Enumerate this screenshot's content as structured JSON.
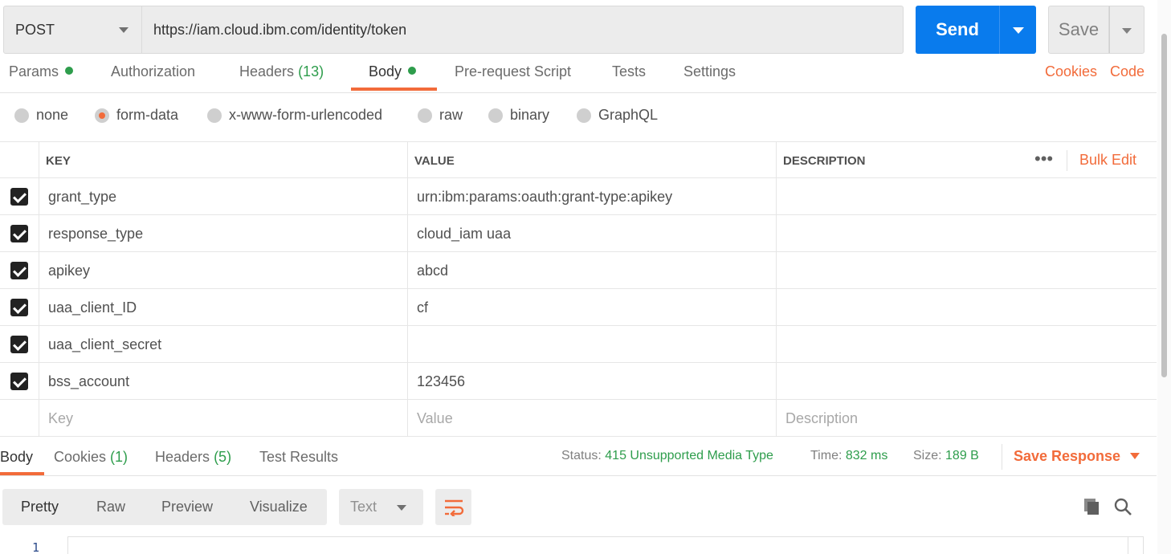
{
  "request": {
    "method": "POST",
    "url": "https://iam.cloud.ibm.com/identity/token",
    "send_label": "Send",
    "save_label": "Save"
  },
  "request_tabs": {
    "params": "Params",
    "authorization": "Authorization",
    "headers": "Headers",
    "headers_count": "(13)",
    "body": "Body",
    "prerequest": "Pre-request Script",
    "tests": "Tests",
    "settings": "Settings",
    "cookies": "Cookies",
    "code": "Code"
  },
  "body_types": {
    "none": "none",
    "form_data": "form-data",
    "urlencoded": "x-www-form-urlencoded",
    "raw": "raw",
    "binary": "binary",
    "graphql": "GraphQL",
    "selected": "form-data"
  },
  "table": {
    "headers": {
      "key": "KEY",
      "value": "VALUE",
      "description": "DESCRIPTION"
    },
    "more_label": "•••",
    "bulk_edit": "Bulk Edit",
    "rows": [
      {
        "key": "grant_type",
        "value": "urn:ibm:params:oauth:grant-type:apikey",
        "description": "",
        "checked": true
      },
      {
        "key": "response_type",
        "value": "cloud_iam uaa",
        "description": "",
        "checked": true
      },
      {
        "key": "apikey",
        "value": "abcd",
        "description": "",
        "checked": true
      },
      {
        "key": "uaa_client_ID",
        "value": "cf",
        "description": "",
        "checked": true
      },
      {
        "key": "uaa_client_secret",
        "value": "",
        "description": "",
        "checked": true
      },
      {
        "key": "bss_account",
        "value": "123456",
        "description": "",
        "checked": true
      }
    ],
    "placeholders": {
      "key": "Key",
      "value": "Value",
      "description": "Description"
    }
  },
  "response": {
    "tabs": {
      "body": "Body",
      "cookies": "Cookies",
      "cookies_count": "(1)",
      "headers": "Headers",
      "headers_count": "(5)",
      "test_results": "Test Results"
    },
    "status_label": "Status:",
    "status_value": "415 Unsupported Media Type",
    "time_label": "Time:",
    "time_value": "832 ms",
    "size_label": "Size:",
    "size_value": "189 B",
    "save_response": "Save Response",
    "views": {
      "pretty": "Pretty",
      "raw": "Raw",
      "preview": "Preview",
      "visualize": "Visualize"
    },
    "format": "Text",
    "line_number": "1"
  },
  "colors": {
    "accent": "#f26b3a",
    "send": "#097bed",
    "success": "#2e9d4c"
  }
}
